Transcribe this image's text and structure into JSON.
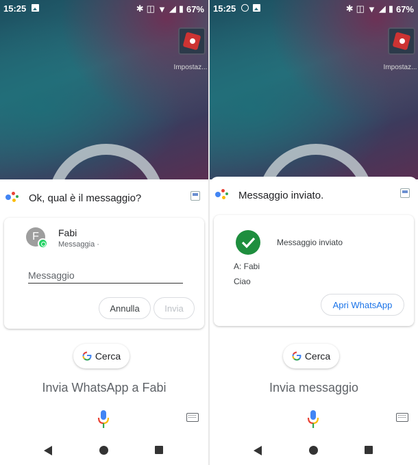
{
  "left": {
    "status": {
      "time": "15:25",
      "battery": "67%"
    },
    "home_app_label": "Impostaz...",
    "prompt": "Ok, qual è il messaggio?",
    "contact": {
      "initial": "F",
      "name": "Fabi",
      "subtitle": "Messaggia ·"
    },
    "message_placeholder": "Messaggio",
    "cancel_label": "Annulla",
    "send_label": "Invia",
    "search_label": "Cerca",
    "query": "Invia WhatsApp a Fabi"
  },
  "right": {
    "status": {
      "time": "15:25",
      "battery": "67%"
    },
    "home_app_label": "Impostaz...",
    "prompt": "Messaggio inviato.",
    "sent_label": "Messaggio inviato",
    "recipient": "A: Fabi",
    "message_body": "Ciao",
    "open_whatsapp_label": "Apri WhatsApp",
    "search_label": "Cerca",
    "query": "Invia messaggio"
  },
  "colors": {
    "assistant_blue": "#4285f4",
    "whatsapp_green": "#25d366",
    "success_green": "#1e8e3e",
    "link_blue": "#1a73e8"
  }
}
